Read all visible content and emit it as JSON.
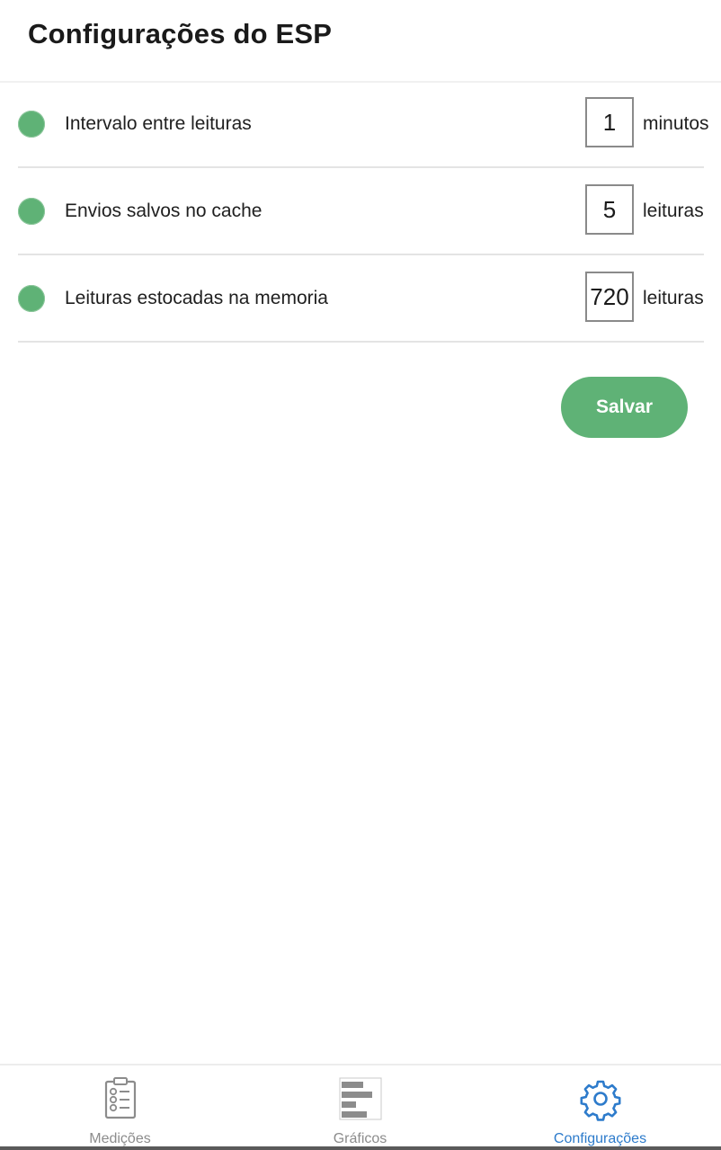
{
  "header": {
    "title": "Configurações do ESP"
  },
  "settings": [
    {
      "label": "Intervalo entre leituras",
      "value": "1",
      "unit": "minutos"
    },
    {
      "label": "Envios salvos no cache",
      "value": "5",
      "unit": "leituras"
    },
    {
      "label": "Leituras estocadas na memoria",
      "value": "720",
      "unit": "leituras"
    }
  ],
  "save_button": {
    "label": "Salvar"
  },
  "tabs": [
    {
      "label": "Medições",
      "icon": "clipboard-checklist-icon",
      "active": false
    },
    {
      "label": "Gráficos",
      "icon": "bar-chart-icon",
      "active": false
    },
    {
      "label": "Configurações",
      "icon": "gear-icon",
      "active": true
    }
  ],
  "colors": {
    "accent_green": "#5fb276",
    "active_tab_blue": "#2d7bcb",
    "inactive_tab_gray": "#8c8c8c"
  }
}
